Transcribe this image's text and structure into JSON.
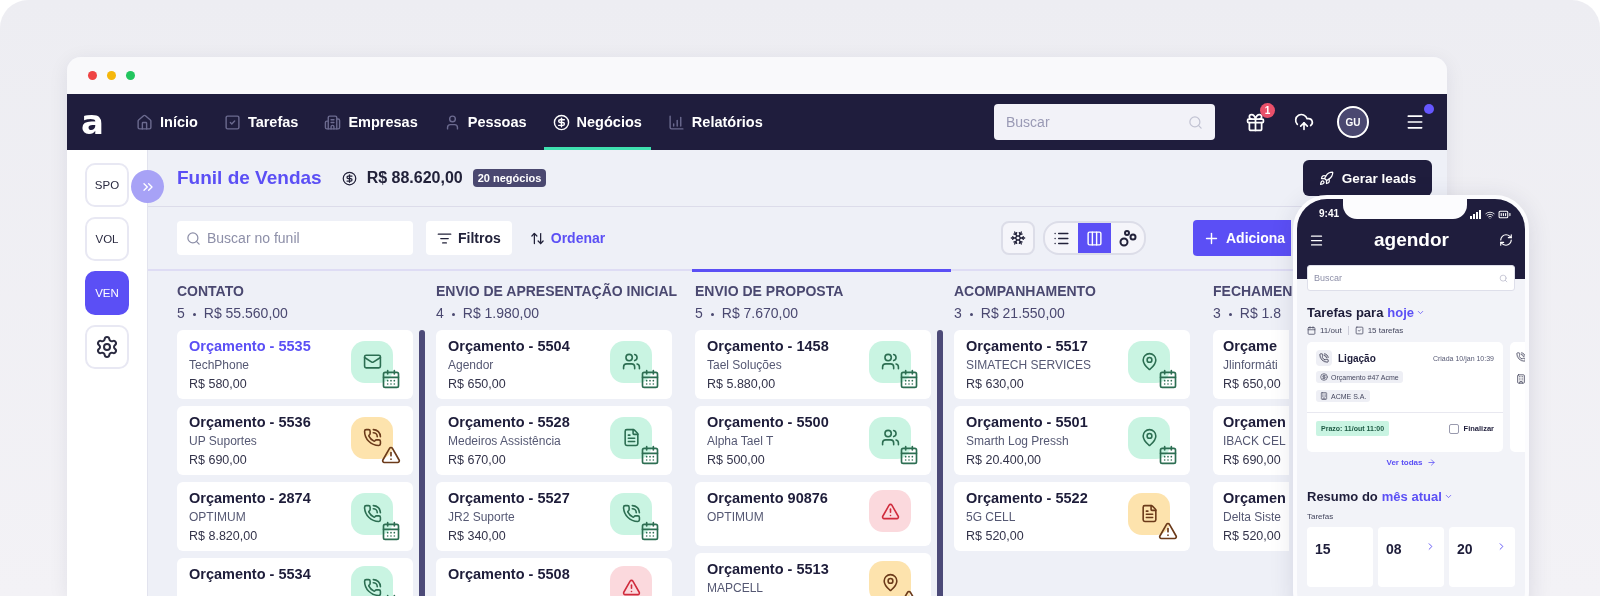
{
  "nav": {
    "logo": "a",
    "items": [
      {
        "label": "Início",
        "selected": false
      },
      {
        "label": "Tarefas",
        "selected": false
      },
      {
        "label": "Empresas",
        "selected": false
      },
      {
        "label": "Pessoas",
        "selected": false
      },
      {
        "label": "Negócios",
        "selected": true
      },
      {
        "label": "Relatórios",
        "selected": false
      }
    ],
    "search": {
      "placeholder": "Buscar"
    },
    "gift_badge": "1",
    "avatar": "GU",
    "menu_notification": true
  },
  "sidebar": {
    "items": [
      {
        "kind": "text",
        "label": "SPO",
        "selected": false
      },
      {
        "kind": "text",
        "label": "VOL",
        "selected": false
      },
      {
        "kind": "text",
        "label": "VEN",
        "selected": true
      },
      {
        "kind": "icon",
        "selected": false
      }
    ]
  },
  "header": {
    "title": "Funil de Vendas",
    "total": "R$ 88.620,00",
    "count": "20 negócios",
    "leads_button": "Gerar leads"
  },
  "toolbar": {
    "search": {
      "placeholder": "Buscar no funil"
    },
    "filter": "Filtros",
    "sort": "Ordenar",
    "views": [
      {
        "selected": false
      },
      {
        "selected": true
      },
      {
        "selected": false
      }
    ],
    "add_button": "Adiciona"
  },
  "columns": [
    {
      "title": "CONTATO",
      "count": "5",
      "total": "R$ 55.560,00",
      "selected": false,
      "scrollable": true,
      "cards": [
        {
          "kind": "mail",
          "title": "Orçamento - 5535",
          "company": "TechPhone",
          "value": "R$ 580,00",
          "overdue": false,
          "selected": true
        },
        {
          "kind": "phone",
          "title": "Orçamento - 5536",
          "company": "UP Suportes",
          "value": "R$ 690,00",
          "overdue": true,
          "selected": false
        },
        {
          "kind": "phone",
          "title": "Orçamento - 2874",
          "company": "OPTIMUM",
          "value": "R$ 8.820,00",
          "overdue": false,
          "selected": false
        },
        {
          "kind": "phone",
          "title": "Orçamento - 5534",
          "overdue": false,
          "selected": false
        }
      ]
    },
    {
      "title": "ENVIO DE APRESENTAÇÃO INICIAL",
      "count": "4",
      "total": "R$ 1.980,00",
      "selected": false,
      "cards": [
        {
          "kind": "people",
          "title": "Orçamento - 5504",
          "company": "Agendor",
          "value": "R$ 650,00",
          "overdue": false,
          "selected": false
        },
        {
          "kind": "document",
          "title": "Orçamento - 5528",
          "company": "Medeiros Assistência",
          "value": "R$ 670,00",
          "overdue": false,
          "selected": false
        },
        {
          "kind": "phone",
          "title": "Orçamento - 5527",
          "company": "JR2 Suporte",
          "value": "R$ 340,00",
          "overdue": false,
          "selected": false
        },
        {
          "kind": "alert",
          "title": "Orçamento - 5508",
          "selected": false
        }
      ]
    },
    {
      "title": "ENVIO DE PROPOSTA",
      "count": "5",
      "total": "R$ 7.670,00",
      "selected": true,
      "scrollable": true,
      "cards": [
        {
          "kind": "people",
          "title": "Orçamento - 1458",
          "company": "Tael Soluções",
          "value": "R$ 5.880,00",
          "overdue": false,
          "selected": false
        },
        {
          "kind": "people",
          "title": "Orçamento - 5500",
          "company": "Alpha Tael T",
          "value": "R$ 500,00",
          "overdue": false,
          "selected": false
        },
        {
          "kind": "alert",
          "title": "Orçamento 90876",
          "company": "OPTIMUM",
          "selected": false
        },
        {
          "kind": "location",
          "title": "Orçamento - 5513",
          "company": "MAPCELL",
          "overdue": true,
          "selected": false
        }
      ]
    },
    {
      "title": "ACOMPANHAMENTO",
      "count": "3",
      "total": "R$ 21.550,00",
      "selected": false,
      "cards": [
        {
          "kind": "location",
          "title": "Orçamento - 5517",
          "company": "SIMATECH SERVICES",
          "value": "R$ 630,00",
          "overdue": false,
          "selected": false
        },
        {
          "kind": "location",
          "title": "Orçamento - 5501",
          "company": "Smarth Log Pressh",
          "value": "R$ 20.400,00",
          "overdue": false,
          "selected": false
        },
        {
          "kind": "document",
          "title": "Orçamento - 5522",
          "company": "5G CELL",
          "value": "R$ 520,00",
          "overdue": true,
          "selected": false
        }
      ]
    },
    {
      "title": "FECHAMEN",
      "count": "3",
      "total": "R$ 1.8",
      "selected": false,
      "cards": [
        {
          "title": "Orçame",
          "company": "Jlinformáti",
          "value": "R$ 650,00",
          "selected": false
        },
        {
          "title": "Orçamen",
          "company": "IBACK CEL",
          "value": "R$ 690,00",
          "selected": false
        },
        {
          "title": "Orçamen",
          "company": "Delta Siste",
          "value": "R$ 520,00",
          "selected": false
        }
      ]
    }
  ],
  "phone": {
    "time": "9:41",
    "logo": "agendor",
    "search": {
      "placeholder": "Buscar"
    },
    "tasks": {
      "title": "Tarefas para",
      "period": "hoje",
      "date": "11/out",
      "count": "15 tarefas",
      "cards": [
        {
          "kind": "full",
          "type": "Ligação",
          "created": "Criada 10/jan 10:39",
          "deal": "Orçamento #47 Acme",
          "company": "ACME S.A.",
          "deadline": "Prazo: 11/out 11:00",
          "action": "Finalizar",
          "checked": false
        },
        {
          "kind": "partial"
        }
      ],
      "see_all": "Ver todas"
    },
    "summary": {
      "title": "Resumo do",
      "period": "mês atual",
      "label": "Tarefas",
      "tiles": [
        {
          "value": "15",
          "arrow": false
        },
        {
          "value": "08",
          "arrow": true
        },
        {
          "value": "20",
          "arrow": true
        }
      ]
    }
  }
}
